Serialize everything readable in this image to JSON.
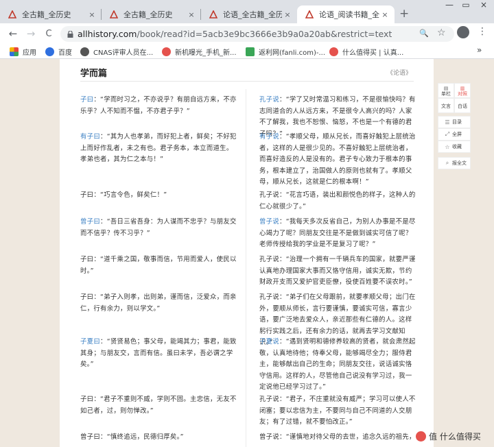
{
  "tabs": [
    {
      "title": "全古籍_全历史",
      "active": false
    },
    {
      "title": "全古籍_全历史",
      "active": false
    },
    {
      "title": "论语_全古籍_全历史",
      "active": false
    },
    {
      "title": "论语_阅读书籍_全历",
      "active": true
    }
  ],
  "tab_close_glyph": "×",
  "new_tab_glyph": "+",
  "window_controls": {
    "minimize": "—",
    "restore": "▭",
    "close": "×"
  },
  "toolbar": {
    "back_glyph": "←",
    "forward_glyph": "→",
    "reload_glyph": "C",
    "search_glyph": "🔍",
    "star_glyph": "☆",
    "menu_glyph": "⋮"
  },
  "url": {
    "host": "allhistory.com",
    "path": "/book/read?id=5acb3e9bc3666e3b9a0a20ab&restrict=text"
  },
  "bookmarks": [
    {
      "label": "应用",
      "color": "#e8453c"
    },
    {
      "label": "百度",
      "color": "#2f6fdf"
    },
    {
      "label": "CNAS评审人员在...",
      "color": "#555555"
    },
    {
      "label": "新机曝光_手机_新...",
      "color": "#e5524d"
    },
    {
      "label": "返利网(fanli.com)-...",
      "color": "#3aa657"
    },
    {
      "label": "什么值得买 | 认真...",
      "color": "#e5524d"
    }
  ],
  "bookmarks_more": "»",
  "content": {
    "heading": "学而篇",
    "crumb": "《论语》",
    "rows": [
      {
        "left": {
          "speaker": "子曰",
          "text": "：“学而时习之，不亦说乎？有朋自远方来，不亦乐乎？人不知而不愠，不亦君子乎？”"
        },
        "right": {
          "speaker": "孔子说",
          "text": "：“学了又时常温习和练习，不是很愉快吗？有志同道合的人从远方来，不是很令人高兴的吗？人家不了解我，我也不恕恨、恼怒，不也是一个有德的君子吗？”"
        }
      },
      {
        "left": {
          "speaker": "有子曰",
          "text": "：“其为人也孝弟，而好犯上者，鲜矣；不好犯上而好作乱者，未之有也。君子务本，本立而道生。孝弟也者，其为仁之本与！”"
        },
        "right": {
          "speaker": "有子说",
          "text": "：“孝顺父母，顺从兄长，而喜好触犯上层统治者，这样的人是很少见的。不喜好触犯上层统治者，而喜好造反的人是没有的。君子专心致力于根本的事务，根本建立了，治国做人的原则也就有了。孝顺父母，顺从兄长，这就是仁的根本啊！”"
        }
      },
      {
        "left": {
          "speaker": "",
          "text": "子曰：“巧言令色，鲜矣仁！”"
        },
        "right": {
          "speaker": "",
          "text": "孔子说：“花言巧语，装出和颜悦色的样子，这种人的仁心就很少了。”"
        }
      },
      {
        "left": {
          "speaker": "曾子曰",
          "text": "：“吾日三省吾身：为人谋而不忠乎？与朋友交而不信乎？传不习乎？”"
        },
        "right": {
          "speaker": "曾子说",
          "text": "：“我每天多次反省自己，为别人办事是不是尽心竭力了呢？同朋友交往是不是做到诚实可信了呢？老师传授给我的学业是不是复习了呢？”"
        }
      },
      {
        "left": {
          "speaker": "",
          "text": "子曰：“道千乘之国，敬事而信，节用而爱人，使民以时。”"
        },
        "right": {
          "speaker": "",
          "text": "孔子说：“治理一个拥有一千辆兵车的国家，就要严谨认真地办理国家大事而又恪守信用，诚实无欺，节约财政开支而又爱护官吏臣僚，役使百姓要不误农时。”"
        }
      },
      {
        "left": {
          "speaker": "",
          "text": "子曰：“弟子入则孝，出则弟，谨而信，泛爱众，而亲仁，行有余力，则以学文。”"
        },
        "right": {
          "speaker": "",
          "text": "孔子说：“弟子们在父母跟前，就要孝顺父母；出门在外，要顺从师长，言行要谨慎，要诚实可信，寡言少语，要广泛地去爱众人，亲近那些有仁德的人。这样躬行实践之后，还有余力的话，就再去学习文献知识。”"
        }
      },
      {
        "left": {
          "speaker": "子夏曰",
          "text": "：“贤贤易色；事父母，能竭其力；事君，能致其身；与朋友交，言而有信。虽曰未学，吾必谓之学矣。”"
        },
        "right": {
          "speaker": "子夏说",
          "text": "：“遇到贤明和德修养较高的贤者，就会肃然起敬，认真地待他；侍奉父母，能够竭尽全力；服侍君主，能够献出自己的生命；同朋友交往，说话诚实恪守信用。这样的人，尽管他自己说没有学习过，我一定说他已经学习过了。”"
        }
      },
      {
        "left": {
          "speaker": "",
          "text": "子曰：“君子不重则不威，学则不固。主忠信，无友不如己者，过，则勿惮改。”"
        },
        "right": {
          "speaker": "",
          "text": "孔子说：“君子，不庄重就没有威严；学习可以使人不闭塞；要以忠信为主，不要同与自己不同道的人交朋友；有了过错，就不要怕改正。”"
        }
      },
      {
        "left": {
          "speaker": "",
          "text": "曾子曰：“慎终追远，民德归厚矣。”"
        },
        "right": {
          "speaker": "",
          "text": "曾子说：“谨慎地对待父母的去世，追念久远的祖先，自"
        }
      }
    ]
  },
  "side_toolbar": {
    "compare": "单栏",
    "compare2": "对照",
    "original": "文言",
    "vernacular": "白话",
    "toc": "目录",
    "fullscreen": "全屏",
    "collect": "收藏",
    "error": "报全文"
  },
  "watermark": "值 什么值得买",
  "colors": {
    "speaker_link": "#3a7fc3",
    "accent": "#e5524d"
  }
}
